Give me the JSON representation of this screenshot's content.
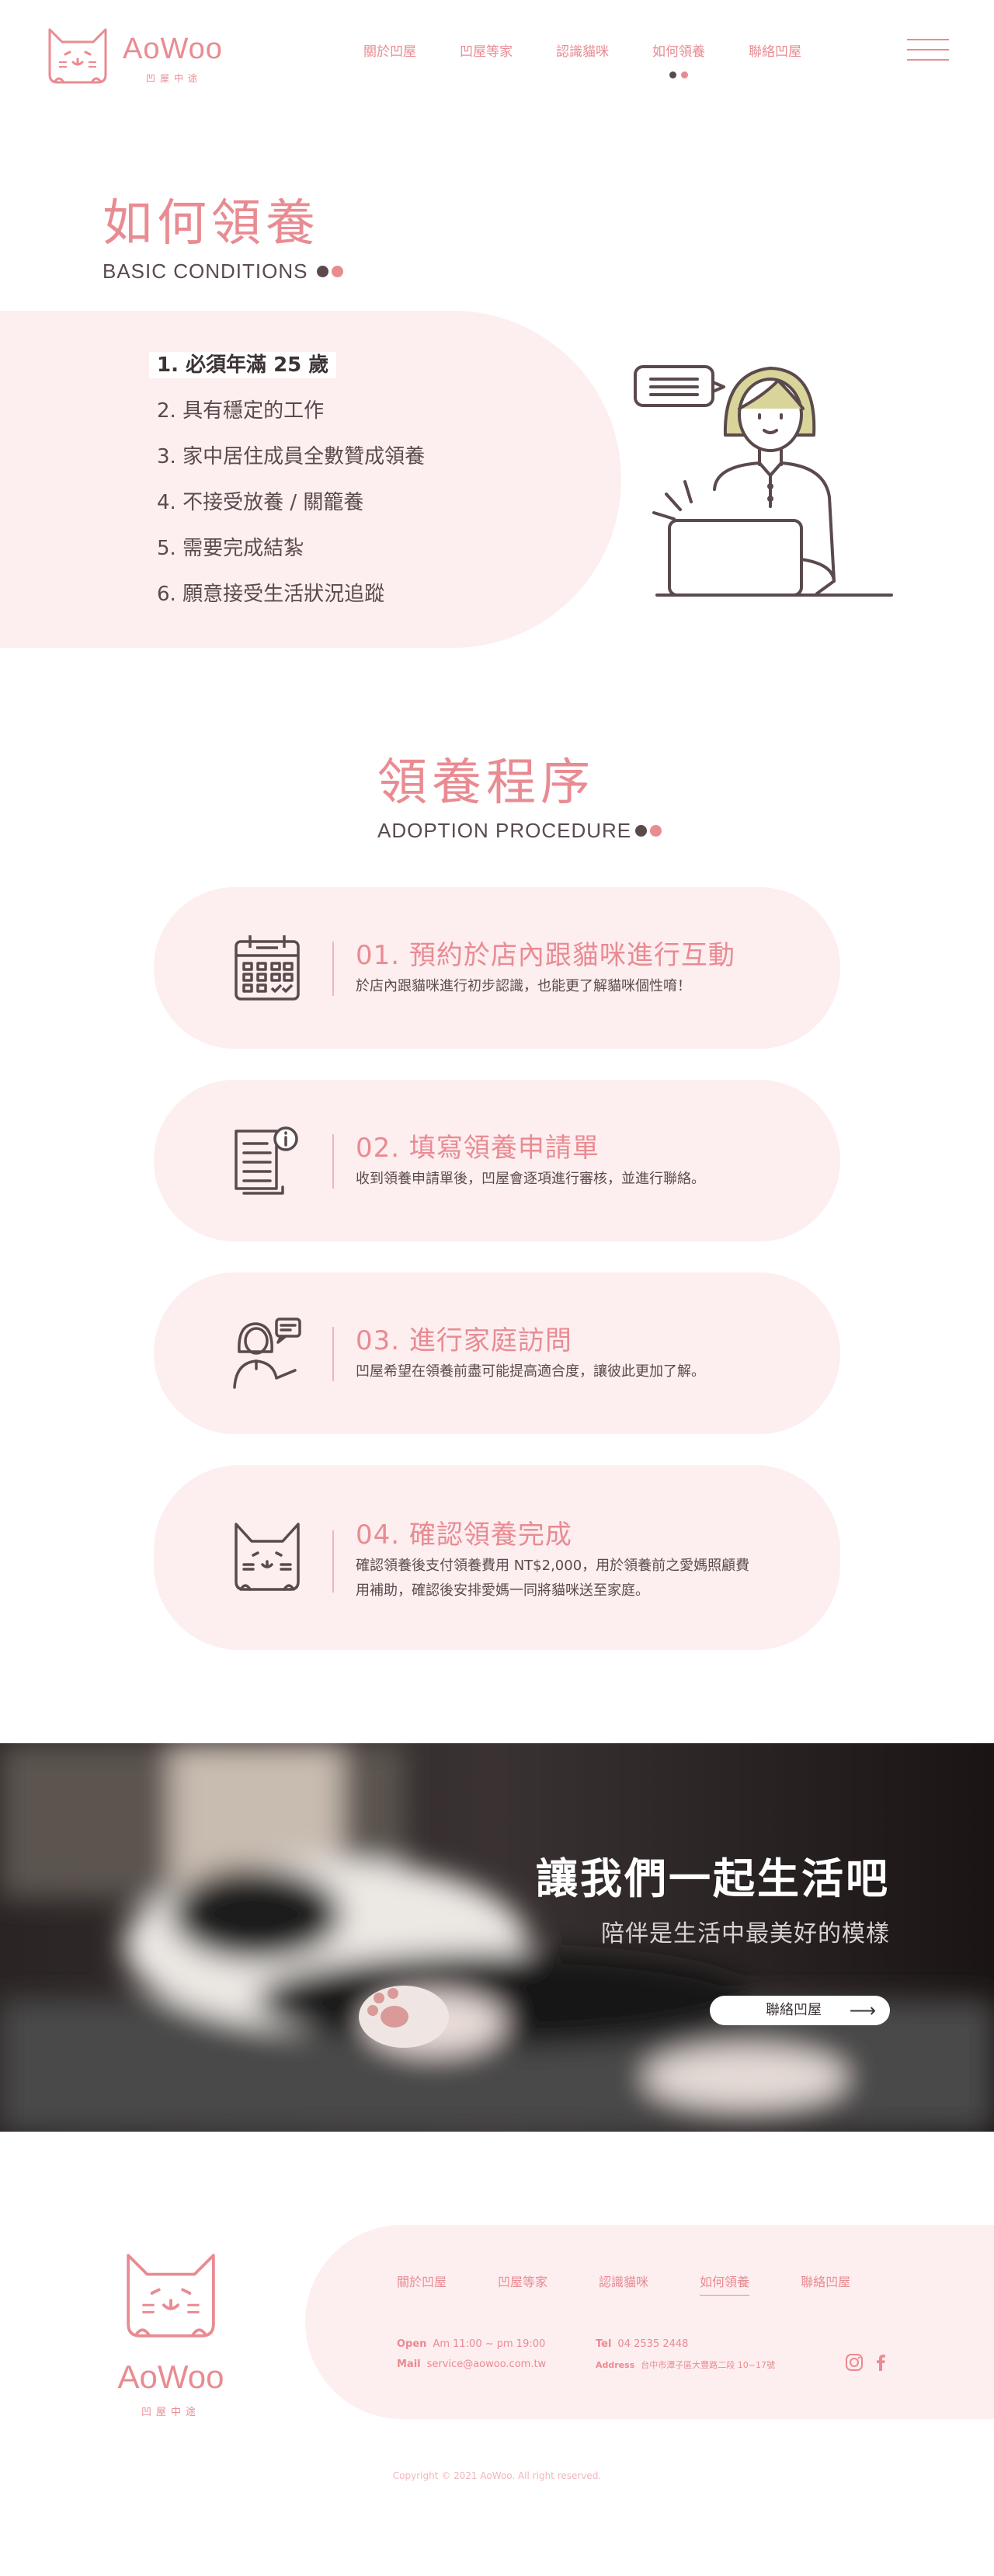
{
  "header": {
    "logo_text": "AoWoo",
    "logo_sub": "凹屋中途",
    "nav": [
      {
        "label": "關於凹屋"
      },
      {
        "label": "凹屋等家"
      },
      {
        "label": "認識貓咪"
      },
      {
        "label": "如何領養",
        "active": true
      },
      {
        "label": "聯絡凹屋"
      }
    ]
  },
  "conditions": {
    "title": "如何領養",
    "subtitle": "BASIC CONDITIONS",
    "items": [
      "1. 必須年滿 25 歲",
      "2. 具有穩定的工作",
      "3. 家中居住成員全數贊成領養",
      "4. 不接受放養 / 關籠養",
      "5. 需要完成結紮",
      "6. 願意接受生活狀況追蹤"
    ]
  },
  "procedure": {
    "title": "領養程序",
    "subtitle": "ADOPTION PROCEDURE",
    "steps": [
      {
        "icon": "calendar-icon",
        "title": "01. 預約於店內跟貓咪進行互動",
        "desc": "於店內跟貓咪進行初步認識，也能更了解貓咪個性唷！"
      },
      {
        "icon": "form-icon",
        "title": "02. 填寫領養申請單",
        "desc": "收到領養申請單後，凹屋會逐項進行審核，並進行聯絡。"
      },
      {
        "icon": "home-visit-icon",
        "title": "03. 進行家庭訪問",
        "desc": "凹屋希望在領養前盡可能提高適合度，讓彼此更加了解。"
      },
      {
        "icon": "cat-face-icon",
        "title": "04. 確認領養完成",
        "desc": "確認領養後支付領養費用 NT$2,000，用於領養前之愛媽照顧費用補助，確認後安排愛媽一同將貓咪送至家庭。"
      }
    ]
  },
  "banner": {
    "heading": "讓我們一起生活吧",
    "subheading": "陪伴是生活中最美好的模樣",
    "button_label": "聯絡凹屋"
  },
  "footer": {
    "logo_text": "AoWoo",
    "logo_sub": "凹屋中途",
    "nav": [
      {
        "label": "關於凹屋"
      },
      {
        "label": "凹屋等家"
      },
      {
        "label": "認識貓咪"
      },
      {
        "label": "如何領養",
        "active": true
      },
      {
        "label": "聯絡凹屋"
      }
    ],
    "open_label": "Open",
    "open_value": "Am 11:00 ~ pm 19:00",
    "mail_label": "Mail",
    "mail_value": "service@aowoo.com.tw",
    "tel_label": "Tel",
    "tel_value": "04 2535 2448",
    "address_label": "Address",
    "address_value": "台中市潭子區大豐路二段 10~17號",
    "copyright": "Copyright © 2021 AoWoo. All right reserved."
  },
  "colors": {
    "accent": "#e98b92",
    "accent_light": "#fdeef0",
    "text_dark": "#5a4a4c"
  }
}
